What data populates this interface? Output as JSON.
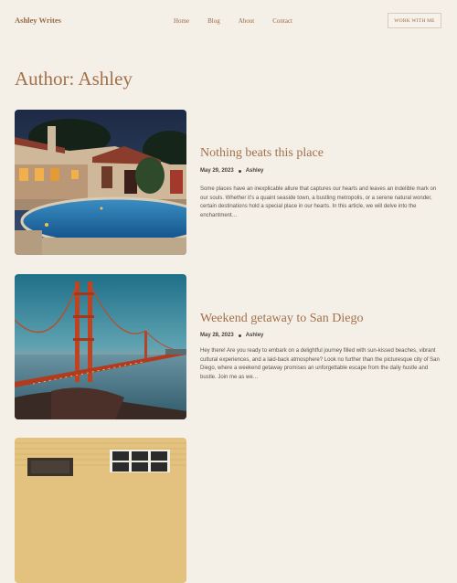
{
  "site": {
    "logo": "Ashley Writes"
  },
  "nav": {
    "items": [
      "Home",
      "Blog",
      "About",
      "Contact"
    ],
    "cta": "WORK WITH ME"
  },
  "page": {
    "title": "Author: Ashley"
  },
  "posts": [
    {
      "title": "Nothing beats this place",
      "date": "May 29, 2023",
      "author": "Ashley",
      "excerpt": "Some places have an inexplicable allure that captures our hearts and leaves an indelible mark on our souls. Whether it’s a quaint seaside town, a bustling metropolis, or a serene natural wonder, certain destinations hold a special place in our hearts. In this article, we will delve into the enchantment…",
      "image": "villa-pool-night"
    },
    {
      "title": "Weekend getaway to San Diego",
      "date": "May 28, 2023",
      "author": "Ashley",
      "excerpt": "Hey there! Are you ready to embark on a delightful journey filled with sun-kissed beaches, vibrant cultural experiences, and a laid-back atmosphere? Look no further than the picturesque city of San Diego, where a weekend getaway promises an unforgettable escape from the daily hustle and bustle. Join me as we…",
      "image": "golden-gate-bridge"
    },
    {
      "image": "yellow-brick-wall-window"
    }
  ]
}
